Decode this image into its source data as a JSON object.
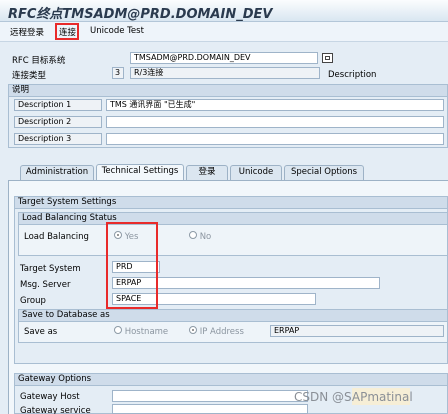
{
  "window": {
    "title": "RFC终点TMSADM@PRD.DOMAIN_DEV"
  },
  "menu": {
    "items": [
      "远程登录",
      "连接",
      "Unicode Test"
    ]
  },
  "header": {
    "dest_label": "RFC 目标系统",
    "dest_value": "TMSADM@PRD.DOMAIN_DEV",
    "conn_type_label": "连接类型",
    "conn_type_code": "3",
    "conn_type_value": "R/3连接",
    "description_label": "Description"
  },
  "desc_group": {
    "title": "说明",
    "rows": [
      {
        "label": "Description 1",
        "value": "TMS 通讯界面 \"已生成\""
      },
      {
        "label": "Description 2",
        "value": ""
      },
      {
        "label": "Description 3",
        "value": ""
      }
    ]
  },
  "tabs": [
    "Administration",
    "Technical Settings",
    "登录",
    "Unicode",
    "Special Options"
  ],
  "target_group": {
    "title": "Target System Settings",
    "lb_status_title": "Load Balancing Status",
    "lb_label": "Load Balancing",
    "lb_yes": "Yes",
    "lb_no": "No",
    "target_system_label": "Target System",
    "target_system_value": "PRD",
    "msg_server_label": "Msg. Server",
    "msg_server_value": "ERPAP",
    "group_label": "Group",
    "group_value": "SPACE",
    "save_db_title": "Save to Database as",
    "save_as_label": "Save as",
    "opt_hostname": "Hostname",
    "opt_ip": "IP Address",
    "save_as_value": "ERPAP"
  },
  "gateway_group": {
    "title": "Gateway Options",
    "host_label": "Gateway Host",
    "service_label": "Gateway service"
  },
  "watermark": "CSDN @SAPmatinal",
  "colors": {
    "highlight_red": "#e82a2a",
    "watermark_box": "#f6eed6"
  }
}
